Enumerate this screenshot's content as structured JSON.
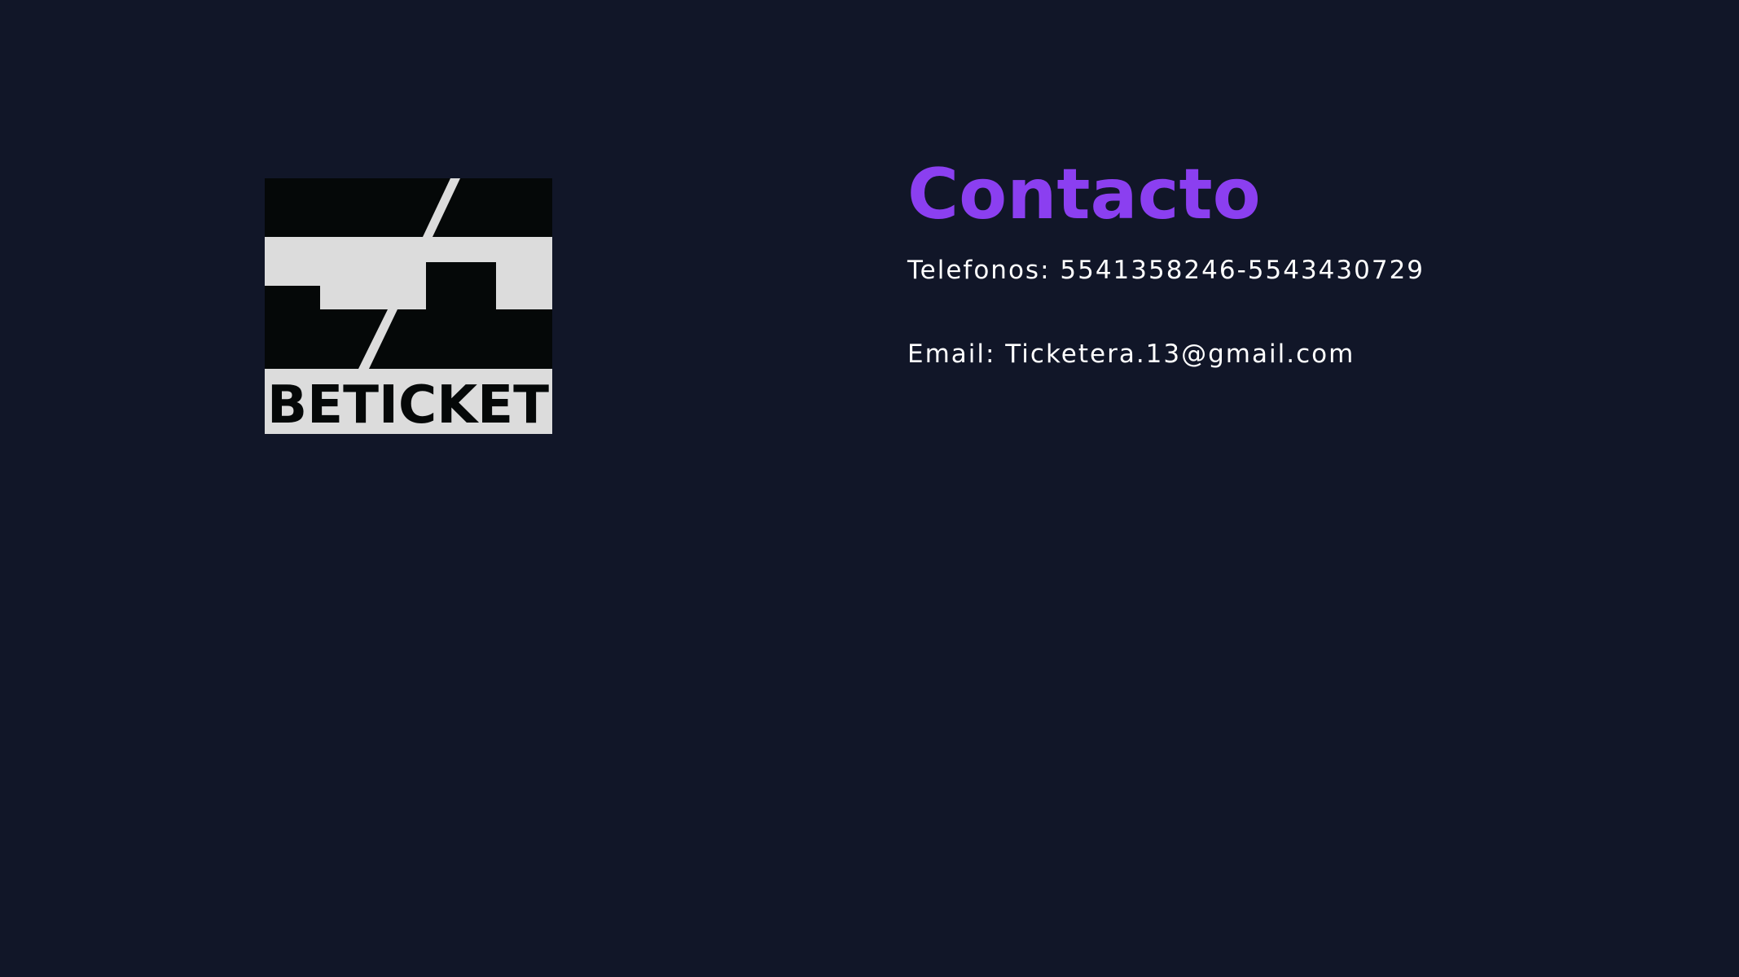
{
  "logo": {
    "wordmark": "BETICKET",
    "colors": {
      "dark": "#050808",
      "light": "#dcdcdc"
    }
  },
  "contact": {
    "title": "Contacto",
    "phones": "Telefonos: 5541358246-5543430729",
    "email": "Email: Ticketera.13@gmail.com"
  },
  "colors": {
    "background": "#111628",
    "accent": "#8b3ff0",
    "text": "#ffffff"
  }
}
